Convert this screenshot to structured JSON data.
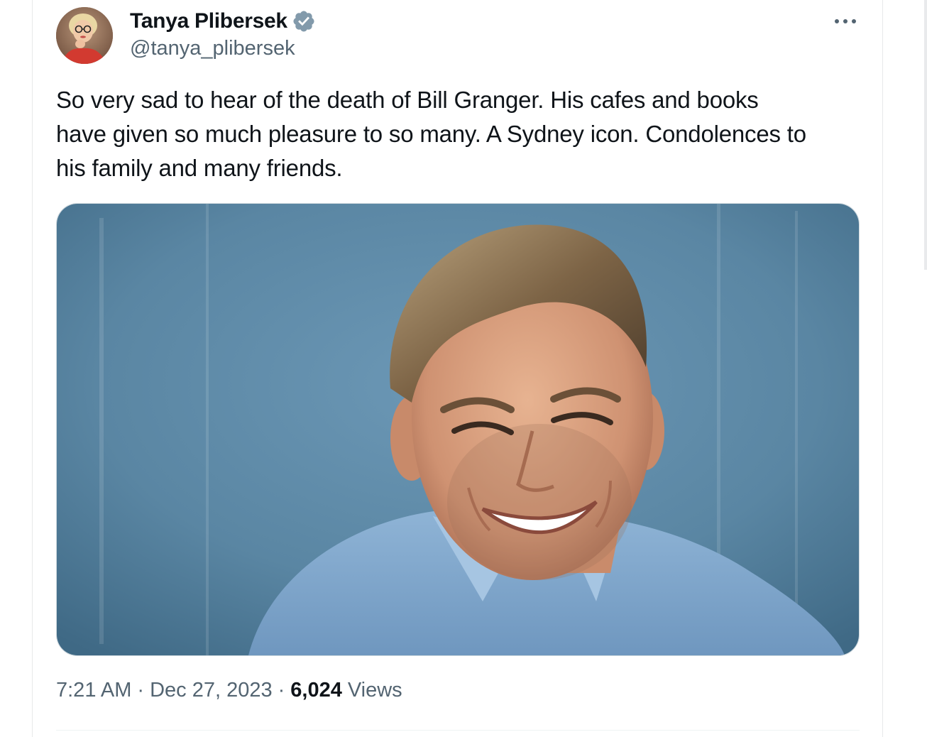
{
  "tweet": {
    "author": {
      "display_name": "Tanya Plibersek",
      "handle": "@tanya_plibersek",
      "verified": true,
      "avatar_icon": "profile-photo"
    },
    "more_icon": "ellipsis-icon",
    "text": "So very sad to hear of the death of Bill Granger. His cafes and books\nhave given so much pleasure to so many. A Sydney icon. Condolences to\nhis family and many friends.",
    "media": {
      "kind": "photo",
      "icon": "photo-portrait"
    },
    "meta": {
      "time": "7:21 AM",
      "separator": "·",
      "date": "Dec 27, 2023",
      "views_count": "6,024",
      "views_label": "Views"
    }
  },
  "colors": {
    "primary_text": "#0f1419",
    "secondary_text": "#536471",
    "verified_badge": "#829aab",
    "border": "#cfd9de",
    "photo_background": "#5b86a4"
  }
}
